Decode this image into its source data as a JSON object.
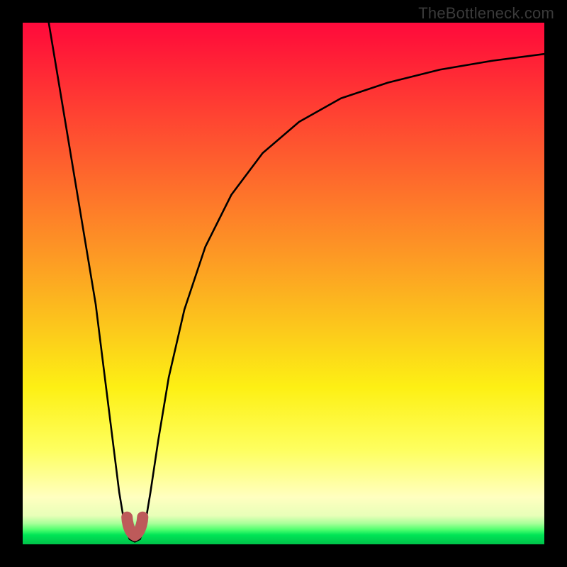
{
  "watermark": "TheBottleneck.com",
  "chart_data": {
    "type": "line",
    "title": "",
    "xlabel": "",
    "ylabel": "",
    "xlim": [
      0,
      100
    ],
    "ylim": [
      0,
      100
    ],
    "series": [
      {
        "name": "curve",
        "x": [
          5,
          8,
          11,
          14,
          16,
          17.5,
          18.5,
          19.5,
          20.5,
          21.5,
          22.5,
          23.5,
          24.5,
          26,
          28,
          31,
          35,
          40,
          46,
          53,
          61,
          70,
          80,
          90,
          100
        ],
        "values": [
          100,
          82,
          64,
          46,
          30,
          18,
          10,
          4,
          1,
          0.5,
          1,
          4,
          10,
          20,
          32,
          45,
          57,
          67,
          75,
          81,
          85.5,
          88.5,
          91,
          92.7,
          94
        ]
      },
      {
        "name": "minimum-marker",
        "x": [
          20,
          20.5,
          21,
          21.5,
          22,
          22.5,
          23
        ],
        "values": [
          5.2,
          3.0,
          2.0,
          1.7,
          2.0,
          3.0,
          5.2
        ]
      }
    ],
    "colors": {
      "curve": "#000000",
      "minimum_marker": "#bd5a5a",
      "gradient_top": "#ff0a3c",
      "gradient_mid": "#fdf014",
      "gradient_bottom": "#00c24a",
      "frame": "#000000"
    }
  }
}
